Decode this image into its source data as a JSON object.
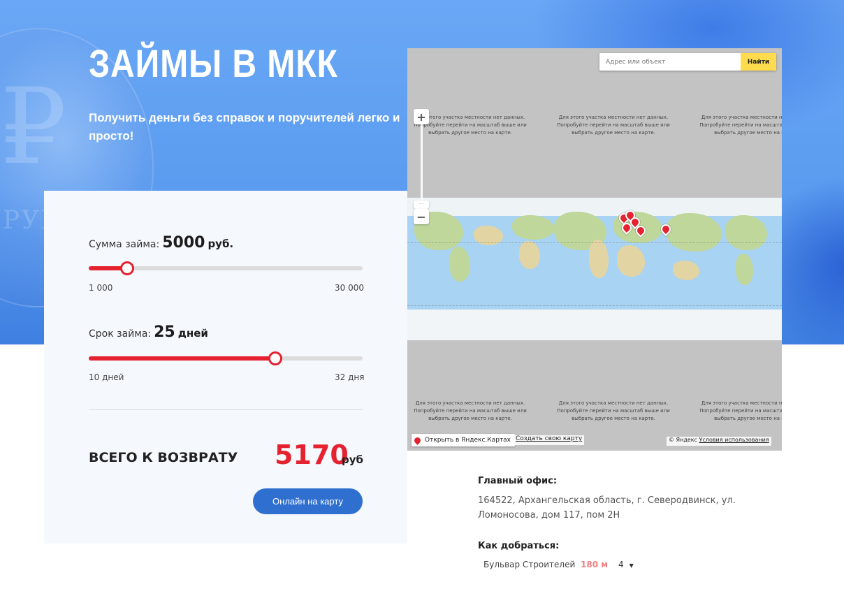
{
  "hero": {
    "title": "ЗАЙМЫ В МКК",
    "subtitle": "Получить деньги без справок и поручителей легко и просто!"
  },
  "calculator": {
    "amount": {
      "label": "Сумма займа:",
      "value": "5000",
      "unit": "руб.",
      "min": "1 000",
      "max": "30 000",
      "position": 0.14
    },
    "term": {
      "label": "Срок займа:",
      "value": "25",
      "unit": "дней",
      "min": "10 дней",
      "max": "32 дня",
      "position": 0.68
    },
    "total_label": "ВСЕГО К ВОЗВРАТУ",
    "total_value": "5170",
    "total_unit": "руб",
    "button_label": "Онлайн на карту"
  },
  "map": {
    "search_placeholder": "Адрес или объект",
    "search_button": "Найти",
    "zoom_in": "+",
    "zoom_out": "−",
    "no_data_text": "Для этого участка местности нет данных. Попробуйте перейти на масштаб выше или выбрать другое место на карте.",
    "open_label": "Открыть в Яндекс.Картах",
    "create_label": "Создать свою карту",
    "copyright": "© Яндекс",
    "terms": "Условия использования"
  },
  "office": {
    "title": "Главный офис:",
    "address": "164522, Архангельская область, г. Северодвинск, ул. Ломоносова, дом 117, пом 2Н",
    "route_title": "Как добраться:",
    "metro_name": "Бульвар Строителей",
    "metro_distance": "180 м",
    "select_value": "4"
  },
  "colors": {
    "accent_red": "#e52230",
    "button_blue": "#2f6fd0",
    "hero_blue": "#5b9cf0",
    "map_search_yellow": "#ffdb4d"
  }
}
